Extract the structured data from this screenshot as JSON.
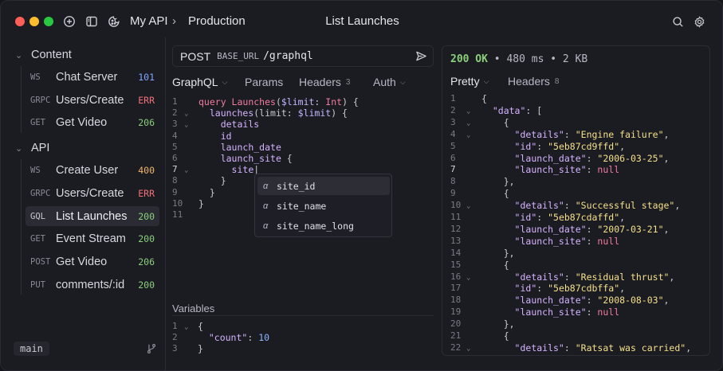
{
  "titlebar": {
    "workspace": "My API",
    "separator": "›",
    "environment": "Production",
    "title": "List Launches"
  },
  "sidebar": {
    "folders": [
      {
        "label": "Content",
        "items": [
          {
            "method": "WS",
            "name": "Chat Server",
            "code": "101",
            "color": "#7fa8ff"
          },
          {
            "method": "GRPC",
            "name": "Users/Create",
            "code": "ERR",
            "color": "#f0707a"
          },
          {
            "method": "GET",
            "name": "Get Video",
            "code": "206",
            "color": "#8ad07a"
          }
        ]
      },
      {
        "label": "API",
        "items": [
          {
            "method": "WS",
            "name": "Create User",
            "code": "400",
            "color": "#f2b56b"
          },
          {
            "method": "GRPC",
            "name": "Users/Create",
            "code": "ERR",
            "color": "#f0707a"
          },
          {
            "method": "GQL",
            "name": "List Launches",
            "code": "200",
            "color": "#8ad07a"
          },
          {
            "method": "GET",
            "name": "Event Stream",
            "code": "200",
            "color": "#8ad07a"
          },
          {
            "method": "POST",
            "name": "Get Video",
            "code": "206",
            "color": "#8ad07a"
          },
          {
            "method": "PUT",
            "name": "comments/:id",
            "code": "200",
            "color": "#8ad07a"
          }
        ]
      }
    ],
    "branch": "main"
  },
  "request": {
    "method": "POST",
    "base": "BASE_URL",
    "path": "/graphql",
    "tabs": [
      {
        "label": "GraphQL",
        "count": "",
        "dropdown": true
      },
      {
        "label": "Params",
        "count": "",
        "dropdown": false
      },
      {
        "label": "Headers",
        "count": "3",
        "dropdown": false
      },
      {
        "label": "Auth",
        "count": "",
        "dropdown": true
      }
    ],
    "query_lines": [
      [
        [
          "c-kw",
          "query "
        ],
        [
          "c-fn",
          "Launches"
        ],
        [
          "c-punc",
          "("
        ],
        [
          "c-var",
          "$limit"
        ],
        [
          "c-punc",
          ": "
        ],
        [
          "c-type",
          "Int"
        ],
        [
          "c-punc",
          ") {"
        ]
      ],
      [
        [
          "c-punc",
          "  "
        ],
        [
          "c-field",
          "launches"
        ],
        [
          "c-punc",
          "(limit: "
        ],
        [
          "c-var",
          "$limit"
        ],
        [
          "c-punc",
          ") {"
        ]
      ],
      [
        [
          "c-punc",
          "    "
        ],
        [
          "c-field",
          "details"
        ]
      ],
      [
        [
          "c-punc",
          "    "
        ],
        [
          "c-field",
          "id"
        ]
      ],
      [
        [
          "c-punc",
          "    "
        ],
        [
          "c-field",
          "launch_date"
        ]
      ],
      [
        [
          "c-punc",
          "    "
        ],
        [
          "c-field",
          "launch_site"
        ],
        [
          "c-punc",
          " {"
        ]
      ],
      [
        [
          "c-punc",
          "      "
        ],
        [
          "c-field",
          "site"
        ],
        [
          "c-punc",
          "|"
        ]
      ],
      [
        [
          "c-punc",
          "    }"
        ]
      ],
      [
        [
          "c-punc",
          "  }"
        ]
      ],
      [
        [
          "c-punc",
          "}"
        ]
      ],
      [
        [
          "c-punc",
          ""
        ]
      ]
    ],
    "query_folds": [
      1,
      2,
      6
    ],
    "autocomplete": [
      "site_id",
      "site_name",
      "site_name_long"
    ],
    "autocomplete_icon": "α",
    "variables_label": "Variables",
    "variables_lines": [
      [
        [
          "c-punc",
          "{"
        ]
      ],
      [
        [
          "c-punc",
          "  "
        ],
        [
          "c-key",
          "\"count\""
        ],
        [
          "c-punc",
          ": "
        ],
        [
          "c-num",
          "10"
        ]
      ],
      [
        [
          "c-punc",
          "}"
        ]
      ]
    ]
  },
  "response": {
    "status_code": "200 OK",
    "time": "480 ms",
    "size": "2 KB",
    "bullet": "•",
    "tabs": [
      {
        "label": "Pretty",
        "count": "",
        "dropdown": true
      },
      {
        "label": "Headers",
        "count": "8",
        "dropdown": false
      }
    ],
    "body_lines": [
      [
        [
          "c-punc",
          "{"
        ]
      ],
      [
        [
          "c-punc",
          "  "
        ],
        [
          "c-key",
          "\"data\""
        ],
        [
          "c-punc",
          ": ["
        ]
      ],
      [
        [
          "c-punc",
          "    {"
        ]
      ],
      [
        [
          "c-punc",
          "      "
        ],
        [
          "c-key",
          "\"details\""
        ],
        [
          "c-punc",
          ": "
        ],
        [
          "c-str",
          "\"Engine failure\""
        ],
        [
          "c-punc",
          ","
        ]
      ],
      [
        [
          "c-punc",
          "      "
        ],
        [
          "c-key",
          "\"id\""
        ],
        [
          "c-punc",
          ": "
        ],
        [
          "c-str",
          "\"5eb87cd9ffd\""
        ],
        [
          "c-punc",
          ","
        ]
      ],
      [
        [
          "c-punc",
          "      "
        ],
        [
          "c-key",
          "\"launch_date\""
        ],
        [
          "c-punc",
          ": "
        ],
        [
          "c-str",
          "\"2006-03-25\""
        ],
        [
          "c-punc",
          ","
        ]
      ],
      [
        [
          "c-punc",
          "      "
        ],
        [
          "c-key",
          "\"launch_site\""
        ],
        [
          "c-punc",
          ": "
        ],
        [
          "c-null",
          "null"
        ]
      ],
      [
        [
          "c-punc",
          "    },"
        ]
      ],
      [
        [
          "c-punc",
          "    {"
        ]
      ],
      [
        [
          "c-punc",
          "      "
        ],
        [
          "c-key",
          "\"details\""
        ],
        [
          "c-punc",
          ": "
        ],
        [
          "c-str",
          "\"Successful stage\""
        ],
        [
          "c-punc",
          ","
        ]
      ],
      [
        [
          "c-punc",
          "      "
        ],
        [
          "c-key",
          "\"id\""
        ],
        [
          "c-punc",
          ": "
        ],
        [
          "c-str",
          "\"5eb87cdaffd\""
        ],
        [
          "c-punc",
          ","
        ]
      ],
      [
        [
          "c-punc",
          "      "
        ],
        [
          "c-key",
          "\"launch_date\""
        ],
        [
          "c-punc",
          ": "
        ],
        [
          "c-str",
          "\"2007-03-21\""
        ],
        [
          "c-punc",
          ","
        ]
      ],
      [
        [
          "c-punc",
          "      "
        ],
        [
          "c-key",
          "\"launch_site\""
        ],
        [
          "c-punc",
          ": "
        ],
        [
          "c-null",
          "null"
        ]
      ],
      [
        [
          "c-punc",
          "    },"
        ]
      ],
      [
        [
          "c-punc",
          "    {"
        ]
      ],
      [
        [
          "c-punc",
          "      "
        ],
        [
          "c-key",
          "\"details\""
        ],
        [
          "c-punc",
          ": "
        ],
        [
          "c-str",
          "\"Residual thrust\""
        ],
        [
          "c-punc",
          ","
        ]
      ],
      [
        [
          "c-punc",
          "      "
        ],
        [
          "c-key",
          "\"id\""
        ],
        [
          "c-punc",
          ": "
        ],
        [
          "c-str",
          "\"5eb87cdbffa\""
        ],
        [
          "c-punc",
          ","
        ]
      ],
      [
        [
          "c-punc",
          "      "
        ],
        [
          "c-key",
          "\"launch_date\""
        ],
        [
          "c-punc",
          ": "
        ],
        [
          "c-str",
          "\"2008-08-03\""
        ],
        [
          "c-punc",
          ","
        ]
      ],
      [
        [
          "c-punc",
          "      "
        ],
        [
          "c-key",
          "\"launch_site\""
        ],
        [
          "c-punc",
          ": "
        ],
        [
          "c-null",
          "null"
        ]
      ],
      [
        [
          "c-punc",
          "    },"
        ]
      ],
      [
        [
          "c-punc",
          "    {"
        ]
      ],
      [
        [
          "c-punc",
          "      "
        ],
        [
          "c-key",
          "\"details\""
        ],
        [
          "c-punc",
          ": "
        ],
        [
          "c-str",
          "\"Ratsat was carried\""
        ],
        [
          "c-punc",
          ","
        ]
      ]
    ],
    "body_folds": [
      1,
      2,
      3,
      9,
      15,
      21
    ]
  },
  "icons": {
    "new": "plus-circle-icon",
    "sidebar_toggle": "sidebar-toggle-icon",
    "cookie": "cookie-icon",
    "search": "search-icon",
    "settings": "gear-icon",
    "send": "send-icon",
    "branch": "git-branch-icon"
  }
}
